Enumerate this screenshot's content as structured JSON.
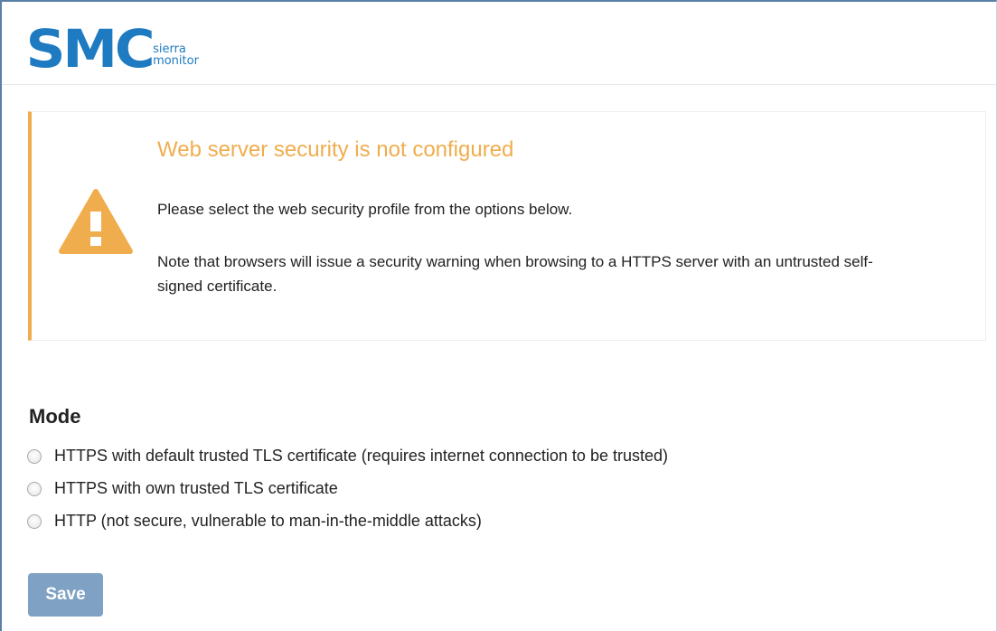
{
  "header": {
    "logo_mark": "SMC",
    "logo_sub_line1": "sierra",
    "logo_sub_line2": "monitor"
  },
  "alert": {
    "icon": "warning-triangle-icon",
    "title": "Web server security is not configured",
    "message": "Please select the web security profile from the options below.",
    "note": "Note that browsers will issue a security warning when browsing to a HTTPS server with an untrusted self-signed certificate."
  },
  "mode": {
    "title": "Mode",
    "options": [
      {
        "label": "HTTPS with default trusted TLS certificate (requires internet connection to be trusted)",
        "selected": false
      },
      {
        "label": "HTTPS with own trusted TLS certificate",
        "selected": false
      },
      {
        "label": "HTTP (not secure, vulnerable to man-in-the-middle attacks)",
        "selected": false
      }
    ]
  },
  "save_label": "Save",
  "colors": {
    "brand_blue": "#1f7bc1",
    "warning": "#f0ad4e",
    "save_button": "#7fa2c4"
  }
}
